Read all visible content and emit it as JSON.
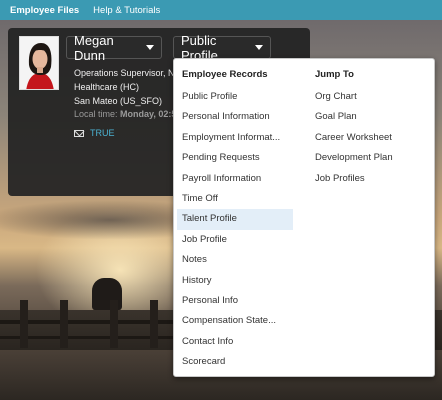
{
  "topbar": {
    "items": [
      {
        "label": "Employee Files",
        "active": true
      },
      {
        "label": "Help & Tutorials",
        "active": false
      }
    ]
  },
  "profile": {
    "name": "Megan Dunn",
    "view_selector": "Public Profile",
    "title_line": "Operations Supervisor, N",
    "department": "Healthcare (HC)",
    "location": "San Mateo (US_SFO)",
    "local_time_label": "Local time:",
    "local_time_value": "Monday, 02:5",
    "email_value": "TRUE"
  },
  "dropdown": {
    "employee_records": {
      "header": "Employee Records",
      "items": [
        "Public Profile",
        "Personal Information",
        "Employment Informat...",
        "Pending Requests",
        "Payroll Information",
        "Time Off",
        "Talent Profile",
        "Job Profile",
        "Notes",
        "History",
        "Personal Info",
        "Compensation State...",
        "Contact Info",
        "Scorecard"
      ],
      "highlighted": "Talent Profile"
    },
    "jump_to": {
      "header": "Jump To",
      "items": [
        "Org Chart",
        "Goal Plan",
        "Career Worksheet",
        "Development Plan",
        "Job Profiles"
      ]
    }
  },
  "colors": {
    "topbar": "#3b9ab3",
    "card_bg": "#222222",
    "link": "#4bb3d3",
    "highlight": "#e3eef8"
  },
  "icons": {
    "email": "mail-icon",
    "name_caret": "chevron-down-icon",
    "view_caret": "chevron-down-icon"
  }
}
